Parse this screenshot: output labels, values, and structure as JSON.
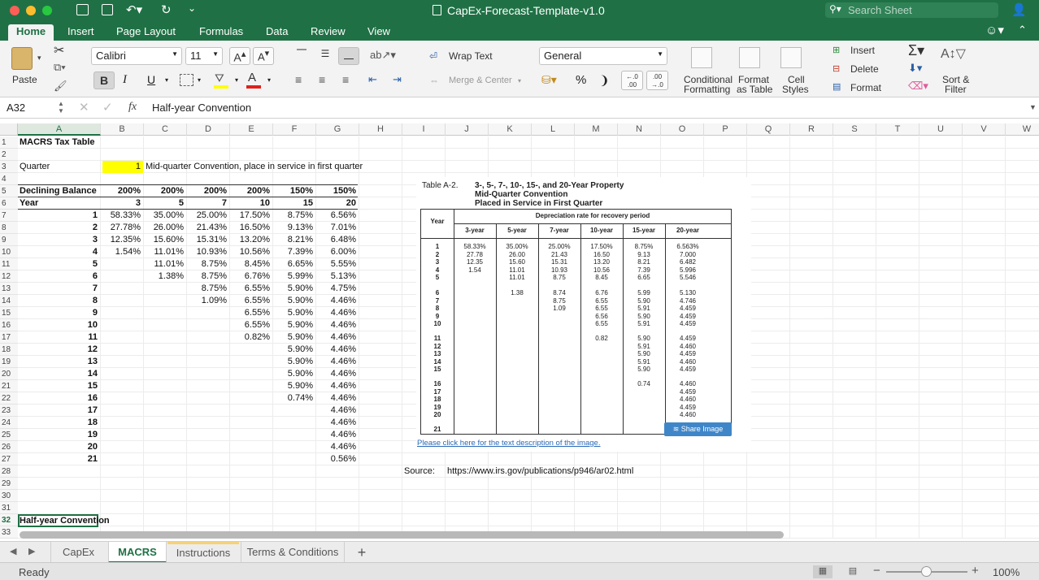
{
  "window": {
    "title": "CapEx-Forecast-Template-v1.0",
    "search_placeholder": "Search Sheet"
  },
  "ribbon_tabs": [
    "Home",
    "Insert",
    "Page Layout",
    "Formulas",
    "Data",
    "Review",
    "View"
  ],
  "ribbon": {
    "paste": "Paste",
    "font_name": "Calibri",
    "font_size": "11",
    "bold": "B",
    "italic": "I",
    "underline": "U",
    "wrap_text": "Wrap Text",
    "merge_center": "Merge & Center",
    "number_format": "General",
    "percent": "%",
    "comma": "❩",
    "cond_format_1": "Conditional",
    "cond_format_2": "Formatting",
    "format_table_1": "Format",
    "format_table_2": "as Table",
    "cell_styles_1": "Cell",
    "cell_styles_2": "Styles",
    "insert": "Insert",
    "delete": "Delete",
    "format": "Format",
    "sort_filter_1": "Sort &",
    "sort_filter_2": "Filter"
  },
  "formula_bar": {
    "cell_ref": "A32",
    "fx": "fx",
    "content": "Half-year Convention"
  },
  "columns": [
    "A",
    "B",
    "C",
    "D",
    "E",
    "F",
    "G",
    "H",
    "I",
    "J",
    "K",
    "L",
    "M",
    "N",
    "O",
    "P",
    "Q",
    "R",
    "S",
    "T",
    "U",
    "V",
    "W"
  ],
  "rows": [
    "1",
    "2",
    "3",
    "4",
    "5",
    "6",
    "7",
    "8",
    "9",
    "10",
    "11",
    "12",
    "13",
    "14",
    "15",
    "16",
    "17",
    "18",
    "19",
    "20",
    "21",
    "22",
    "23",
    "24",
    "25",
    "26",
    "27",
    "28",
    "29",
    "30",
    "31",
    "32",
    "33"
  ],
  "sheet": {
    "title": "MACRS Tax Table",
    "quarter_label": "Quarter",
    "quarter_value": "1",
    "quarter_note": "Mid-quarter Convention, place in service in first quarter",
    "db_label": "Declining Balance",
    "year_label": "Year",
    "db_rates": [
      "200%",
      "200%",
      "200%",
      "200%",
      "150%",
      "150%"
    ],
    "recovery_years": [
      "3",
      "5",
      "7",
      "10",
      "15",
      "20"
    ],
    "years": [
      "1",
      "2",
      "3",
      "4",
      "5",
      "6",
      "7",
      "8",
      "9",
      "10",
      "11",
      "12",
      "13",
      "14",
      "15",
      "16",
      "17",
      "18",
      "19",
      "20",
      "21"
    ],
    "table": [
      [
        "58.33%",
        "35.00%",
        "25.00%",
        "17.50%",
        "8.75%",
        "6.56%"
      ],
      [
        "27.78%",
        "26.00%",
        "21.43%",
        "16.50%",
        "9.13%",
        "7.01%"
      ],
      [
        "12.35%",
        "15.60%",
        "15.31%",
        "13.20%",
        "8.21%",
        "6.48%"
      ],
      [
        "1.54%",
        "11.01%",
        "10.93%",
        "10.56%",
        "7.39%",
        "6.00%"
      ],
      [
        "",
        "11.01%",
        "8.75%",
        "8.45%",
        "6.65%",
        "5.55%"
      ],
      [
        "",
        "1.38%",
        "8.75%",
        "6.76%",
        "5.99%",
        "5.13%"
      ],
      [
        "",
        "",
        "8.75%",
        "6.55%",
        "5.90%",
        "4.75%"
      ],
      [
        "",
        "",
        "1.09%",
        "6.55%",
        "5.90%",
        "4.46%"
      ],
      [
        "",
        "",
        "",
        "6.55%",
        "5.90%",
        "4.46%"
      ],
      [
        "",
        "",
        "",
        "6.55%",
        "5.90%",
        "4.46%"
      ],
      [
        "",
        "",
        "",
        "0.82%",
        "5.90%",
        "4.46%"
      ],
      [
        "",
        "",
        "",
        "",
        "5.90%",
        "4.46%"
      ],
      [
        "",
        "",
        "",
        "",
        "5.90%",
        "4.46%"
      ],
      [
        "",
        "",
        "",
        "",
        "5.90%",
        "4.46%"
      ],
      [
        "",
        "",
        "",
        "",
        "5.90%",
        "4.46%"
      ],
      [
        "",
        "",
        "",
        "",
        "0.74%",
        "4.46%"
      ],
      [
        "",
        "",
        "",
        "",
        "",
        "4.46%"
      ],
      [
        "",
        "",
        "",
        "",
        "",
        "4.46%"
      ],
      [
        "",
        "",
        "",
        "",
        "",
        "4.46%"
      ],
      [
        "",
        "",
        "",
        "",
        "",
        "4.46%"
      ],
      [
        "",
        "",
        "",
        "",
        "",
        "0.56%"
      ]
    ],
    "source_label": "Source:",
    "source_url": "https://www.irs.gov/publications/p946/ar02.html",
    "a32": "Half-year Convention"
  },
  "irs_image": {
    "label": "Table A-2.",
    "title1": "3-, 5-, 7-, 10-, 15-, and 20-Year Property",
    "title2": "Mid-Quarter Convention",
    "title3": "Placed in Service in First Quarter",
    "header_year": "Year",
    "header_rate": "Depreciation rate for recovery period",
    "periods": [
      "3-year",
      "5-year",
      "7-year",
      "10-year",
      "15-year",
      "20-year"
    ],
    "year_groups": [
      "1\n2\n3\n4\n5",
      "6\n7\n8\n9\n10",
      "11\n12\n13\n14\n15",
      "16\n17\n18\n19\n20",
      "21"
    ],
    "col_groups": [
      [
        "58.33%\n27.78\n12.35\n1.54",
        "",
        "",
        "",
        ""
      ],
      [
        "35.00%\n26.00\n15.60\n11.01\n11.01",
        "1.38",
        "",
        "",
        ""
      ],
      [
        "25.00%\n21.43\n15.31\n10.93\n8.75",
        "8.74\n8.75\n1.09",
        "",
        "",
        ""
      ],
      [
        "17.50%\n16.50\n13.20\n10.56\n8.45",
        "6.76\n6.55\n6.55\n6.56\n6.55",
        "0.82",
        "",
        ""
      ],
      [
        "8.75%\n9.13\n8.21\n7.39\n6.65",
        "5.99\n5.90\n5.91\n5.90\n5.91",
        "5.90\n5.91\n5.90\n5.91\n5.90",
        "0.74",
        ""
      ],
      [
        "6.563%\n7.000\n6.482\n5.996\n5.546",
        "5.130\n4.746\n4.459\n4.459\n4.459",
        "4.459\n4.460\n4.459\n4.460\n4.459",
        "4.460\n4.459\n4.460\n4.459\n4.460",
        ""
      ]
    ],
    "share_button": "Share Image",
    "link_text": "Please click here for the text description of the image."
  },
  "sheet_tabs": [
    "CapEx",
    "MACRS",
    "Instructions",
    "Terms & Conditions"
  ],
  "active_sheet": "MACRS",
  "status": {
    "ready": "Ready",
    "zoom": "100%"
  },
  "colors": {
    "excel_green": "#1f7145",
    "highlight_yellow": "#ffff00",
    "link_blue": "#2a6ab8"
  }
}
